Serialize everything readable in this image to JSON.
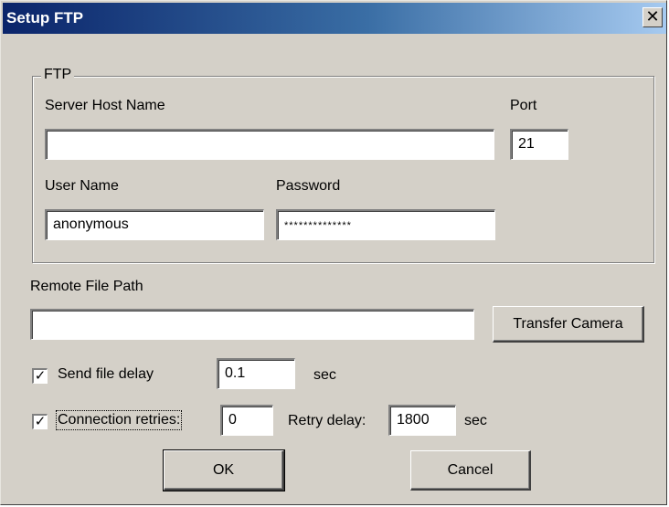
{
  "window": {
    "title": "Setup FTP",
    "close_glyph": "✕"
  },
  "ftp_group": {
    "legend": "FTP",
    "server_host_label": "Server Host Name",
    "server_host_value": "",
    "port_label": "Port",
    "port_value": "21",
    "user_label": "User Name",
    "user_value": "anonymous",
    "password_label": "Password",
    "password_value": "**************"
  },
  "remote": {
    "label": "Remote File Path",
    "value": "",
    "transfer_button": "Transfer Camera"
  },
  "send_delay": {
    "checked": true,
    "label": "Send file delay",
    "value": "0.1",
    "unit": "sec"
  },
  "retries": {
    "checked": true,
    "label": "Connection retries:",
    "value": "0",
    "retry_delay_label": "Retry delay:",
    "retry_delay_value": "1800",
    "unit": "sec"
  },
  "buttons": {
    "ok": "OK",
    "cancel": "Cancel"
  },
  "check_glyph": "✓"
}
